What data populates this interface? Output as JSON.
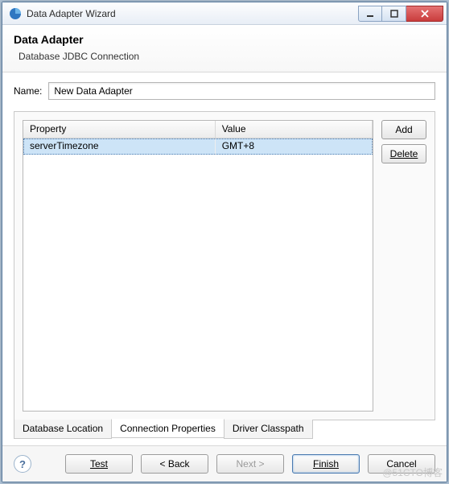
{
  "window": {
    "title": "Data Adapter Wizard"
  },
  "banner": {
    "title": "Data Adapter",
    "subtitle": "Database JDBC Connection"
  },
  "form": {
    "name_label": "Name:",
    "name_value": "New Data Adapter"
  },
  "table": {
    "columns": {
      "property": "Property",
      "value": "Value"
    },
    "rows": [
      {
        "property": "serverTimezone",
        "value": "GMT+8"
      }
    ]
  },
  "side_buttons": {
    "add": "Add",
    "delete": "Delete"
  },
  "tabs": {
    "db_location": "Database Location",
    "conn_props": "Connection Properties",
    "driver_cp": "Driver Classpath"
  },
  "footer": {
    "test": "Test",
    "back": "< Back",
    "next": "Next >",
    "finish": "Finish",
    "cancel": "Cancel"
  },
  "watermark": "@51CTO博客"
}
